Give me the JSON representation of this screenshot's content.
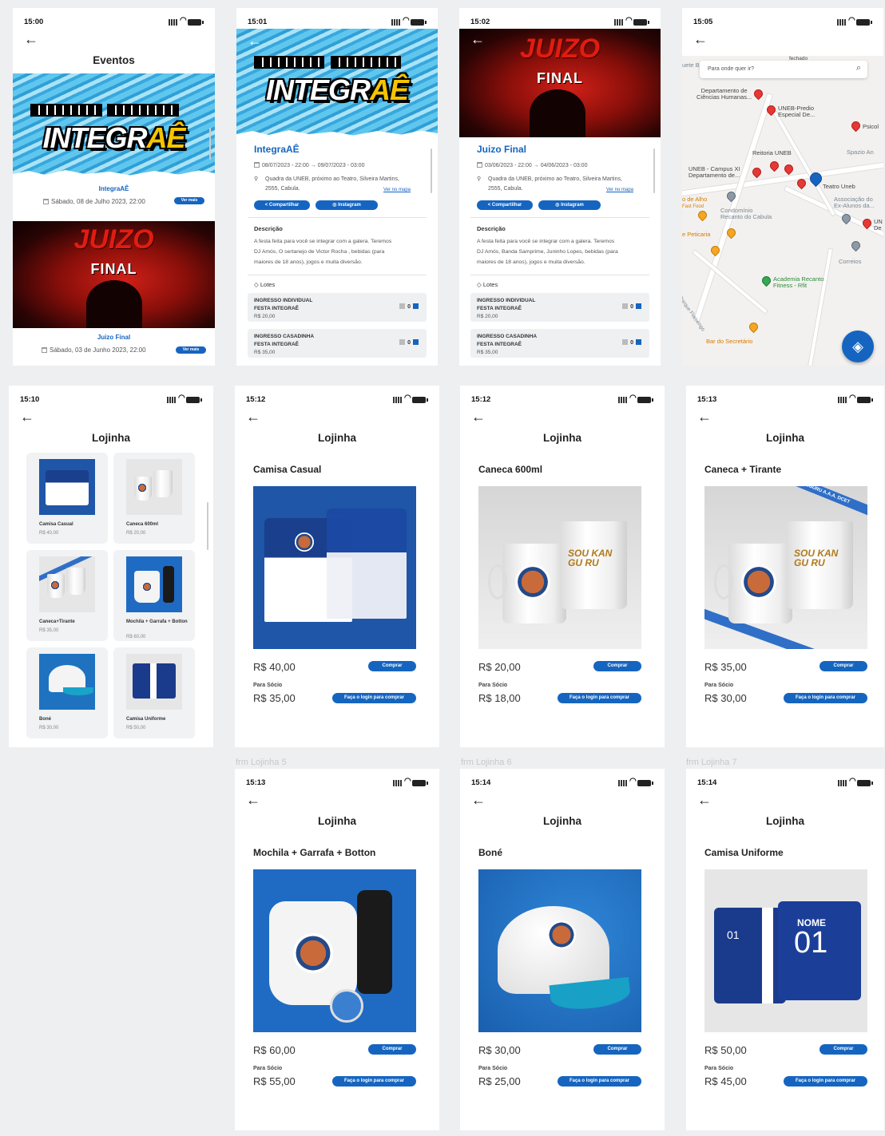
{
  "labels": {
    "frm5": "frm Lojinha 5",
    "frm6": "frm Lojinha 6",
    "frm7": "frm Lojinha 7"
  },
  "eventos": {
    "time": "15:00",
    "title": "Eventos",
    "events": [
      {
        "name": "IntegraAÊ",
        "date": "Sábado, 08 de Julho 2023, 22:00",
        "button": "Ver mais",
        "banner_text_1": "INTEGR",
        "banner_text_2": "AÊ"
      },
      {
        "name": "Juizo Final",
        "date": "Sábado, 03 de Junho 2023, 22:00",
        "button": "Ver mais",
        "banner_text_1": "JUIZO",
        "banner_text_2": "FINAL"
      }
    ]
  },
  "integra_detail": {
    "time": "15:01",
    "title": "IntegraAÊ",
    "banner_text_1": "INTEGR",
    "banner_text_2": "AÊ",
    "start": "08/07/2023 - 22:00",
    "arrow": "→",
    "end": "09/07/2023 - 03:00",
    "address_1": "Quadra da UNEB, próximo ao Teatro, Silveira Martins,",
    "address_2": "2555, Cabula.",
    "map_link": "Ver no mapa",
    "share": "Compartilhar",
    "instagram": "Instagram",
    "desc_label": "Descrição",
    "desc_1": "A festa feita para você se integrar com a galera. Teremos",
    "desc_2": "DJ Amós, O sertanejo de Victor Rocha , bebidas (para",
    "desc_3": "maiores de 18 anos), jogos e muita diversão.",
    "lotes_label": "Lotes",
    "lotes": [
      {
        "l1": "INGRESSO INDIVIDUAL",
        "l2": "FESTA INTEGRAÊ",
        "price": "R$ 20,00",
        "qty": "0"
      },
      {
        "l1": "INGRESSO CASADINHA",
        "l2": "FESTA INTEGRAÊ",
        "price": "R$ 35,00",
        "qty": "0"
      }
    ]
  },
  "juizo_detail": {
    "time": "15:02",
    "title": "Juizo Final",
    "banner_text_1": "JUIZO",
    "banner_text_2": "FINAL",
    "start": "03/06/2023 - 22:00",
    "arrow": "→",
    "end": "04/06/2023 - 03:00",
    "address_1": "Quadra da UNEB, próximo ao Teatro, Silveira Martins,",
    "address_2": "2555, Cabula.",
    "map_link": "Ver no mapa",
    "share": "Compartilhar",
    "instagram": "Instagram",
    "desc_label": "Descrição",
    "desc_1": "A festa feita para você se integrar com a galera. Teremos",
    "desc_2": "DJ Amós, Banda Samprime, Juninho Lopes, bebidas (para",
    "desc_3": "maiores de 18 anos), jogos e muita diversão.",
    "lotes_label": "Lotes",
    "lotes": [
      {
        "l1": "INGRESSO INDIVIDUAL",
        "l2": "FESTA INTEGRAÊ",
        "price": "R$ 20,00",
        "qty": "0"
      },
      {
        "l1": "INGRESSO CASADINHA",
        "l2": "FESTA INTEGRAÊ",
        "price": "R$ 35,00",
        "qty": "0"
      }
    ]
  },
  "map": {
    "time": "15:05",
    "search_placeholder": "Para onde quer ir?",
    "top_text": "fechado",
    "left_top": "uete Br",
    "places": {
      "dep": "Departamento de",
      "dep2": "Ciências Humanas...",
      "predio": "UNEB-Predio",
      "predio2": "Especial De...",
      "psicol": "Psicol",
      "reitoria": "Reitoria UNEB",
      "spazio": "Spazio An",
      "campus": "UNEB - Campus XI",
      "campus2": "Departamento de...",
      "teatro": "Teatro Uneb",
      "assoc": "Associação do",
      "assoc2": "Ex-Alunos da...",
      "alho": "o de Alho",
      "fastfood": "Fast Food",
      "condo": "Condomínio",
      "condo2": "Recanto do Cabula",
      "unde": "UN",
      "unde2": "De",
      "peticaria": "e Peticaria",
      "correios": "Correios",
      "academia": "Academia Recanto",
      "academia2": "Fitness - Rfit",
      "street": "Parque Flamengo",
      "bar": "Bar do Secretário"
    }
  },
  "lojinha_grid": {
    "time": "15:10",
    "title": "Lojinha",
    "items": [
      {
        "name": "Camisa Casual",
        "price": "R$ 40,00"
      },
      {
        "name": "Caneca 600ml",
        "price": "R$ 20,00"
      },
      {
        "name": "Caneca+Tirante",
        "price": "R$ 35,00"
      },
      {
        "name": "Mochila + Garrafa + Botton",
        "price": "R$ 60,00"
      },
      {
        "name": "Boné",
        "price": "R$ 30,00"
      },
      {
        "name": "Camisa Uniforme",
        "price": "R$ 50,00"
      }
    ]
  },
  "products": [
    {
      "time": "15:12",
      "title": "Lojinha",
      "name": "Camisa Casual",
      "price": "R$ 40,00",
      "buy": "Comprar",
      "socio_label": "Para Sócio",
      "socio_price": "R$ 35,00",
      "login": "Faça o login para comprar"
    },
    {
      "time": "15:12",
      "title": "Lojinha",
      "name": "Caneca 600ml",
      "price": "R$ 20,00",
      "buy": "Comprar",
      "socio_label": "Para Sócio",
      "socio_price": "R$ 18,00",
      "login": "Faça o login para comprar",
      "mug_text": "SOU KAN GU RU"
    },
    {
      "time": "15:13",
      "title": "Lojinha",
      "name": "Caneca + Tirante",
      "price": "R$ 35,00",
      "buy": "Comprar",
      "socio_label": "Para Sócio",
      "socio_price": "R$ 30,00",
      "login": "Faça o login para comprar",
      "mug_text": "SOU KAN GU RU",
      "strap_text": "#SOUKANGURU A.A.A. DCET"
    },
    {
      "time": "15:13",
      "title": "Lojinha",
      "name": "Mochila + Garrafa + Botton",
      "price": "R$ 60,00",
      "buy": "Comprar",
      "socio_label": "Para Sócio",
      "socio_price": "R$ 55,00",
      "login": "Faça o login para comprar"
    },
    {
      "time": "15:14",
      "title": "Lojinha",
      "name": "Boné",
      "price": "R$ 30,00",
      "buy": "Comprar",
      "socio_label": "Para Sócio",
      "socio_price": "R$ 25,00",
      "login": "Faça o login para comprar"
    },
    {
      "time": "15:14",
      "title": "Lojinha",
      "name": "Camisa Uniforme",
      "price": "R$ 50,00",
      "buy": "Comprar",
      "socio_label": "Para Sócio",
      "socio_price": "R$ 45,00",
      "login": "Faça o login para comprar",
      "shirt_name": "NOME",
      "shirt_num": "01",
      "sleeve_num": "01"
    }
  ],
  "colors": {
    "accent": "#1565c0",
    "banner_blue": "#3aa8de",
    "banner_red": "#b8140d",
    "tile_bg": "#f1f2f4"
  }
}
